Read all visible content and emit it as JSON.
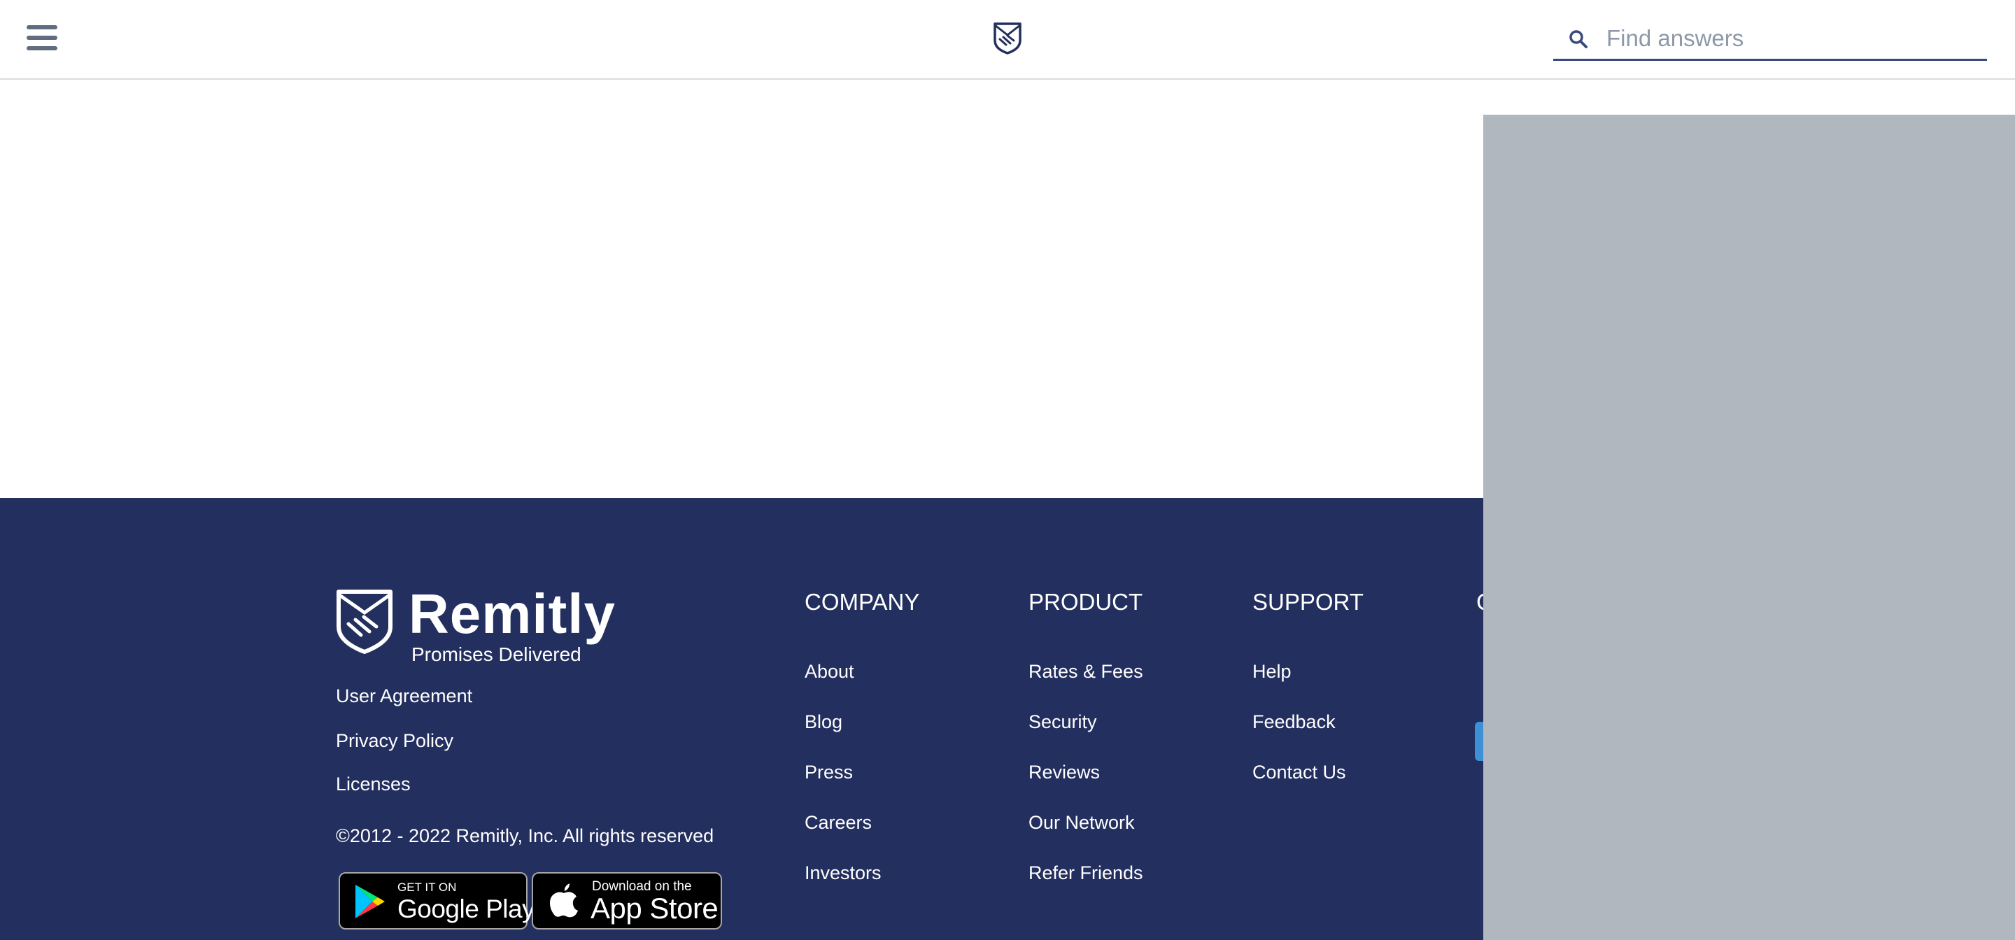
{
  "header": {
    "menu_icon": "hamburger-menu-icon",
    "logo_icon": "remitly-shield-icon",
    "search": {
      "icon": "search-icon",
      "placeholder": "Find answers",
      "value": ""
    }
  },
  "footer": {
    "brand": {
      "name": "Remitly",
      "tagline": "Promises Delivered",
      "logo_icon": "remitly-shield-icon"
    },
    "legal_links": [
      "User Agreement",
      "Privacy Policy",
      "Licenses"
    ],
    "copyright": "©2012 - 2022 Remitly, Inc. All rights reserved",
    "store_badges": {
      "google": {
        "small": "GET IT ON",
        "big": "Google Play",
        "icon": "google-play-icon"
      },
      "apple": {
        "small": "Download on the",
        "big": "App Store",
        "icon": "apple-icon"
      }
    },
    "columns": [
      {
        "heading": "COMPANY",
        "links": [
          "About",
          "Blog",
          "Press",
          "Careers",
          "Investors"
        ]
      },
      {
        "heading": "PRODUCT",
        "links": [
          "Rates & Fees",
          "Security",
          "Reviews",
          "Our Network",
          "Refer Friends"
        ]
      },
      {
        "heading": "SUPPORT",
        "links": [
          "Help",
          "Feedback",
          "Contact Us"
        ]
      }
    ],
    "partial_column_heading": "C"
  },
  "colors": {
    "footer_bg": "#232f5e",
    "overlay_bg": "#b1b7be",
    "accent": "#3d8fd6"
  }
}
